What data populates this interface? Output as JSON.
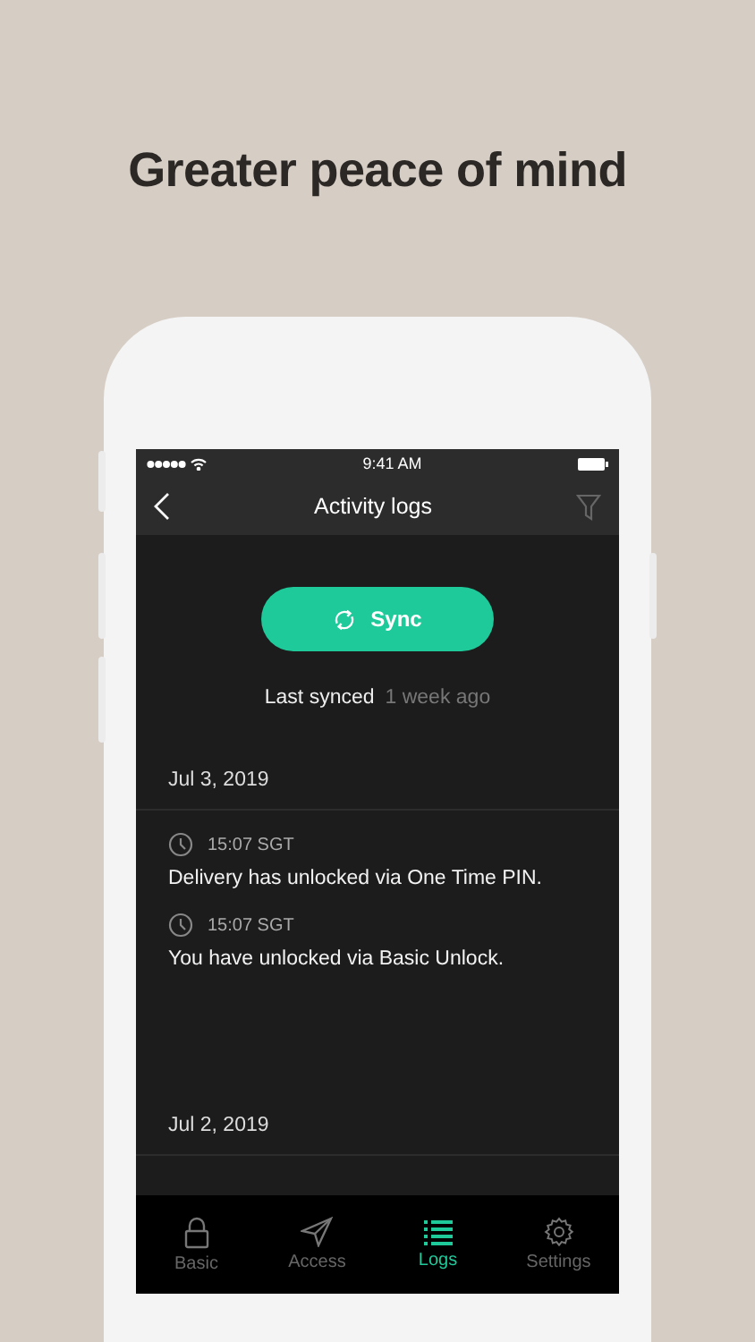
{
  "headline": "Greater peace of mind",
  "status_bar": {
    "time": "9:41 AM"
  },
  "nav": {
    "title": "Activity logs"
  },
  "sync": {
    "label": "Sync",
    "last_synced_label": "Last synced",
    "last_synced_value": "1 week ago"
  },
  "log_groups": [
    {
      "date": "Jul 3, 2019",
      "entries": [
        {
          "time": "15:07 SGT",
          "message": "Delivery has unlocked via One Time PIN."
        },
        {
          "time": "15:07 SGT",
          "message": "You have unlocked via Basic Unlock."
        }
      ]
    },
    {
      "date": "Jul 2, 2019"
    }
  ],
  "tabs": [
    {
      "label": "Basic",
      "kind": "lock",
      "selected": false
    },
    {
      "label": "Access",
      "kind": "send",
      "selected": false
    },
    {
      "label": "Logs",
      "kind": "list",
      "selected": true
    },
    {
      "label": "Settings",
      "kind": "gear",
      "selected": false
    }
  ]
}
